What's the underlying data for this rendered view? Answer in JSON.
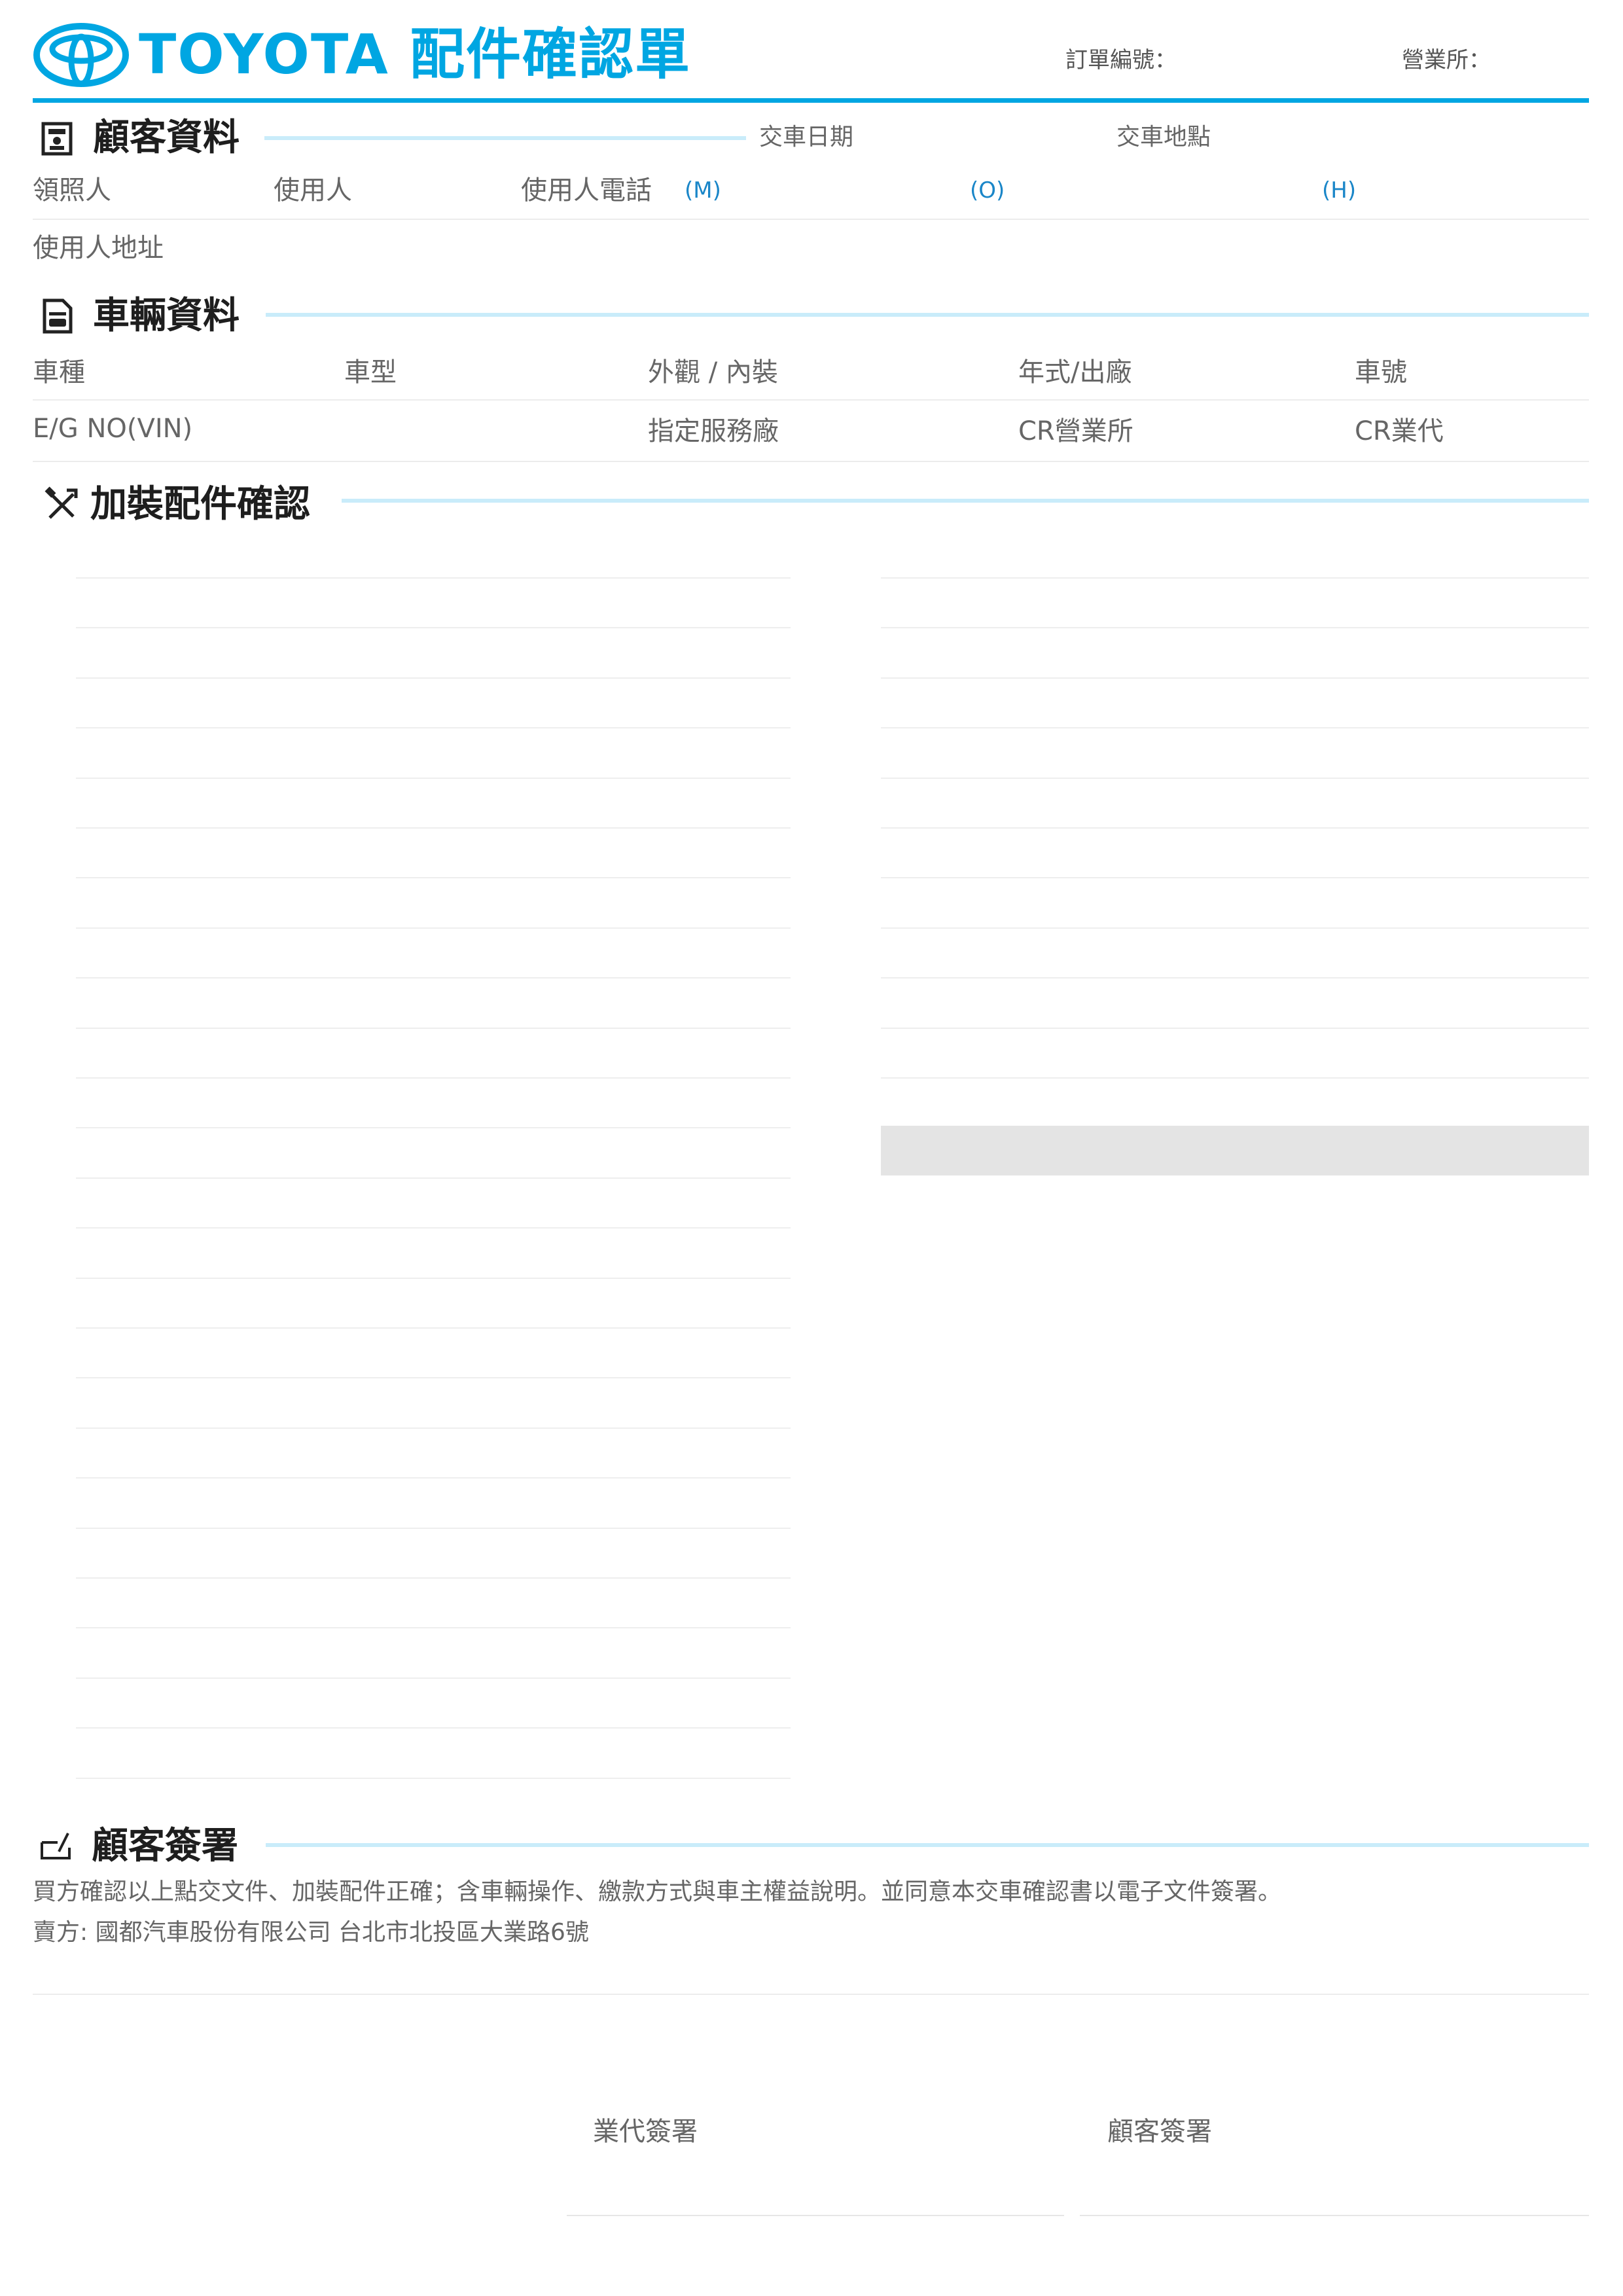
{
  "header": {
    "brand": "TOYOTA",
    "doc_title": "配件確認單",
    "order_no_label": "訂單編號：",
    "office_label": "營業所："
  },
  "customer": {
    "title": "顧客資料",
    "delivery_date": "交車日期",
    "delivery_place": "交車地點",
    "licensee": "領照人",
    "user": "使用人",
    "user_phone": "使用人電話",
    "phone_m": "(M)",
    "phone_o": "(O)",
    "phone_h": "(H)",
    "user_address": "使用人地址"
  },
  "vehicle": {
    "title": "車輛資料",
    "car_kind": "車種",
    "car_model": "車型",
    "exterior_interior": "外觀 / 內裝",
    "year_factory": "年式/出廠",
    "plate": "車號",
    "engine_vin": "E/G NO(VIN)",
    "service_plant": "指定服務廠",
    "cr_office": "CR營業所",
    "cr_agent": "CR業代"
  },
  "accessories": {
    "title": "加裝配件確認",
    "left_rows": 25,
    "right_rows": 12
  },
  "signature": {
    "title": "顧客簽署",
    "statement": "買方確認以上點交文件、加裝配件正確；含車輛操作、繳款方式與車主權益說明。並同意本交車確認書以電子文件簽署。",
    "seller": "賣方: 國都汽車股份有限公司 台北市北投區大業路6號",
    "agent_sign": "業代簽署",
    "customer_sign": "顧客簽署"
  },
  "colors": {
    "brand_blue": "#00a6e2",
    "section_line": "#c9ecfa",
    "gray_block": "#e4e4e4"
  },
  "icons": {
    "logo": "toyota-logo-icon",
    "customer": "id-card-icon",
    "vehicle": "document-car-icon",
    "accessories": "tools-icon",
    "signature": "sign-icon"
  }
}
